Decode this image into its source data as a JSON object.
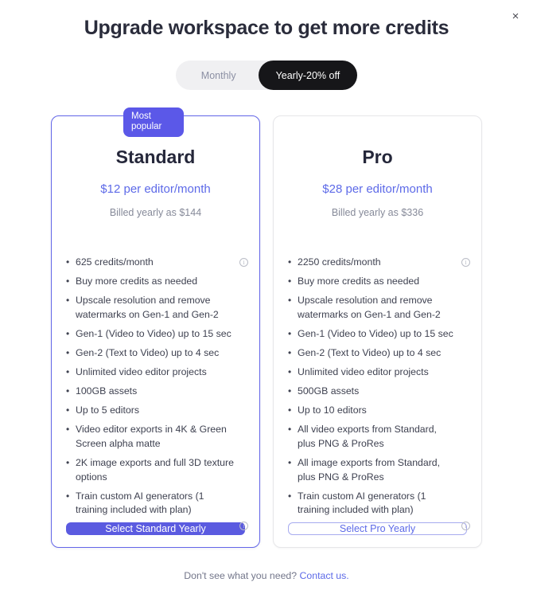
{
  "modal": {
    "title": "Upgrade workspace to get more credits",
    "close_icon": "close-icon",
    "close_label": "×"
  },
  "billing_toggle": {
    "monthly_label": "Monthly",
    "yearly_label": "Yearly-20% off",
    "selected": "yearly"
  },
  "colors": {
    "accent_blue": "#5b58e8",
    "button_blue": "#5b5be0",
    "price_blue": "#5d6ae8",
    "title_navy": "#2a2c3b",
    "toggle_active_bg": "#161619",
    "toggle_track_bg": "#f0f0f2"
  },
  "plans": [
    {
      "badge": "Most popular",
      "name": "Standard",
      "price": "$12 per editor/month",
      "billed": "Billed yearly as $144",
      "features": [
        {
          "text": "625 credits/month",
          "info": true
        },
        {
          "text": "Buy more credits as needed",
          "info": false
        },
        {
          "text": "Upscale resolution and remove watermarks on Gen-1 and Gen-2",
          "info": false
        },
        {
          "text": "Gen-1 (Video to Video) up to 15 sec",
          "info": false
        },
        {
          "text": "Gen-2 (Text to Video) up to 4 sec",
          "info": false
        },
        {
          "text": "Unlimited video editor projects",
          "info": false
        },
        {
          "text": "100GB assets",
          "info": false
        },
        {
          "text": "Up to 5 editors",
          "info": false
        },
        {
          "text": "Video editor exports in 4K & Green Screen alpha matte",
          "info": false
        },
        {
          "text": "2K image exports and full 3D texture options",
          "info": false
        },
        {
          "text": "Train custom AI generators (1 training included with plan)",
          "info": true
        }
      ],
      "cta": "Select Standard Yearly"
    },
    {
      "badge": null,
      "name": "Pro",
      "price": "$28 per editor/month",
      "billed": "Billed yearly as $336",
      "features": [
        {
          "text": "2250 credits/month",
          "info": true
        },
        {
          "text": "Buy more credits as needed",
          "info": false
        },
        {
          "text": "Upscale resolution and remove watermarks on Gen-1 and Gen-2",
          "info": false
        },
        {
          "text": "Gen-1 (Video to Video) up to 15 sec",
          "info": false
        },
        {
          "text": "Gen-2 (Text to Video) up to 4 sec",
          "info": false
        },
        {
          "text": "Unlimited video editor projects",
          "info": false
        },
        {
          "text": "500GB assets",
          "info": false
        },
        {
          "text": "Up to 10 editors",
          "info": false
        },
        {
          "text": "All video exports from Standard, plus PNG & ProRes",
          "info": false
        },
        {
          "text": "All image exports from Standard, plus PNG & ProRes",
          "info": false
        },
        {
          "text": "Train custom AI generators (1 training included with plan)",
          "info": true
        }
      ],
      "cta": "Select Pro Yearly"
    }
  ],
  "footer": {
    "text": "Don't see what you need?",
    "link": "Contact us."
  }
}
